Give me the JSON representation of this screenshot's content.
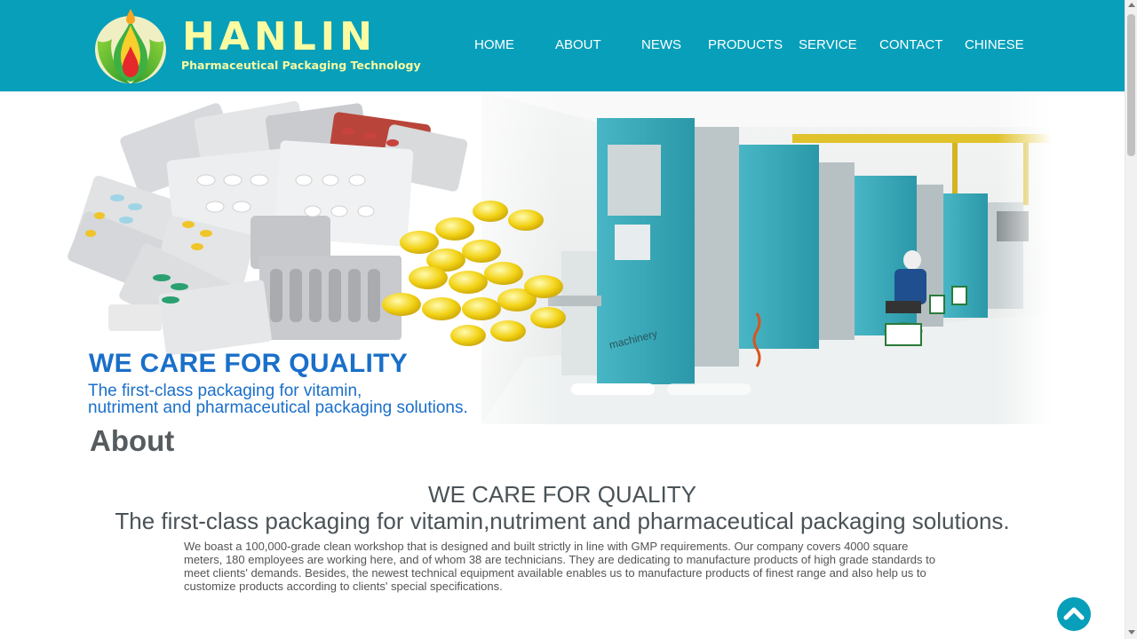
{
  "brand": {
    "name": "HANLIN",
    "tagline": "Pharmaceutical Packaging Technology"
  },
  "nav": {
    "items": [
      {
        "label": "HOME"
      },
      {
        "label": "ABOUT"
      },
      {
        "label": "NEWS"
      },
      {
        "label": "PRODUCTS"
      },
      {
        "label": "SERVICE"
      },
      {
        "label": "CONTACT"
      },
      {
        "label": "CHINESE"
      }
    ]
  },
  "banner": {
    "title": "WE CARE FOR QUALITY",
    "subtitle_line1": "The first-class packaging for vitamin,",
    "subtitle_line2": "nutriment and pharmaceutical packaging solutions.",
    "machine_label": "machinery",
    "slide_count": 2,
    "active_slide": 1
  },
  "about": {
    "heading": "About",
    "tagline": "WE CARE FOR QUALITY",
    "tagline2": "The first-class packaging for vitamin,nutriment and pharmaceutical packaging solutions.",
    "description": "We boast a 100,000-grade clean workshop that is designed and built strictly in line with GMP requirements. Our company covers 4000 square meters, 180 employees are working here, and of whom 38 are technicians. They are dedicating to manufacture products of high grade standards to meet clients' demands. Besides, the newest technical equipment available enables us to manufacture products of finest range and also help us to customize products according to clients' special specifications."
  },
  "colors": {
    "header_bg": "#079fba",
    "brand_text": "#fbfba2",
    "banner_text": "#1a6fc9",
    "heading_text": "#555b5e"
  },
  "icons": {
    "logo": "hanlin-drop-logo",
    "back_to_top": "chevron-up-icon"
  }
}
